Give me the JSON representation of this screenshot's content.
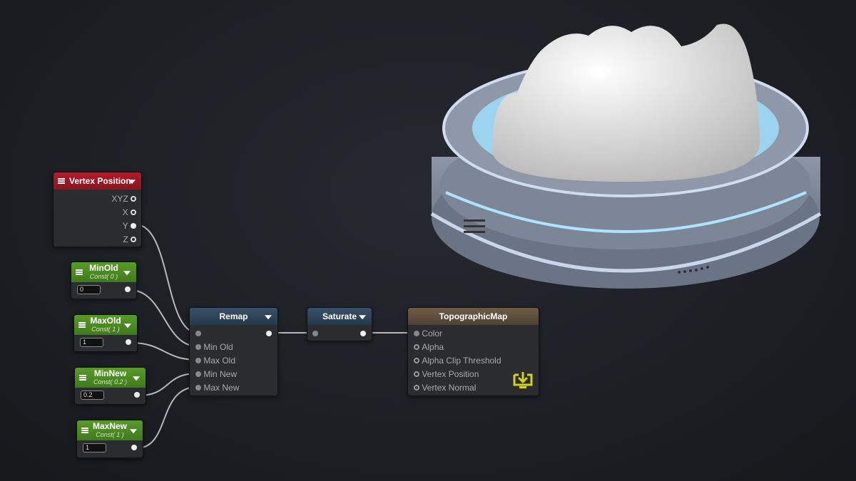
{
  "nodes": {
    "vertex_position": {
      "title": "Vertex Position",
      "outputs": [
        "XYZ",
        "X",
        "Y",
        "Z"
      ]
    },
    "min_old": {
      "title": "MinOld",
      "subtitle": "Const( 0 )",
      "value": "0"
    },
    "max_old": {
      "title": "MaxOld",
      "subtitle": "Const( 1 )",
      "value": "1"
    },
    "min_new": {
      "title": "MinNew",
      "subtitle": "Const( 0.2 )",
      "value": "0.2"
    },
    "max_new": {
      "title": "MaxNew",
      "subtitle": "Const( 1 )",
      "value": "1"
    },
    "remap": {
      "title": "Remap",
      "inputs": [
        "",
        "Min Old",
        "Max Old",
        "Min New",
        "Max New"
      ]
    },
    "saturate": {
      "title": "Saturate"
    },
    "output": {
      "title": "TopographicMap",
      "inputs": [
        "Color",
        "Alpha",
        "Alpha Clip Threshold",
        "Vertex Position",
        "Vertex Normal"
      ]
    }
  },
  "colors": {
    "vertex_header": "#b01d2c",
    "const_header": "#5a9a2c",
    "function_header": "#3a5068",
    "output_header": "#6e5c48",
    "output_icon": "#d4d020"
  }
}
